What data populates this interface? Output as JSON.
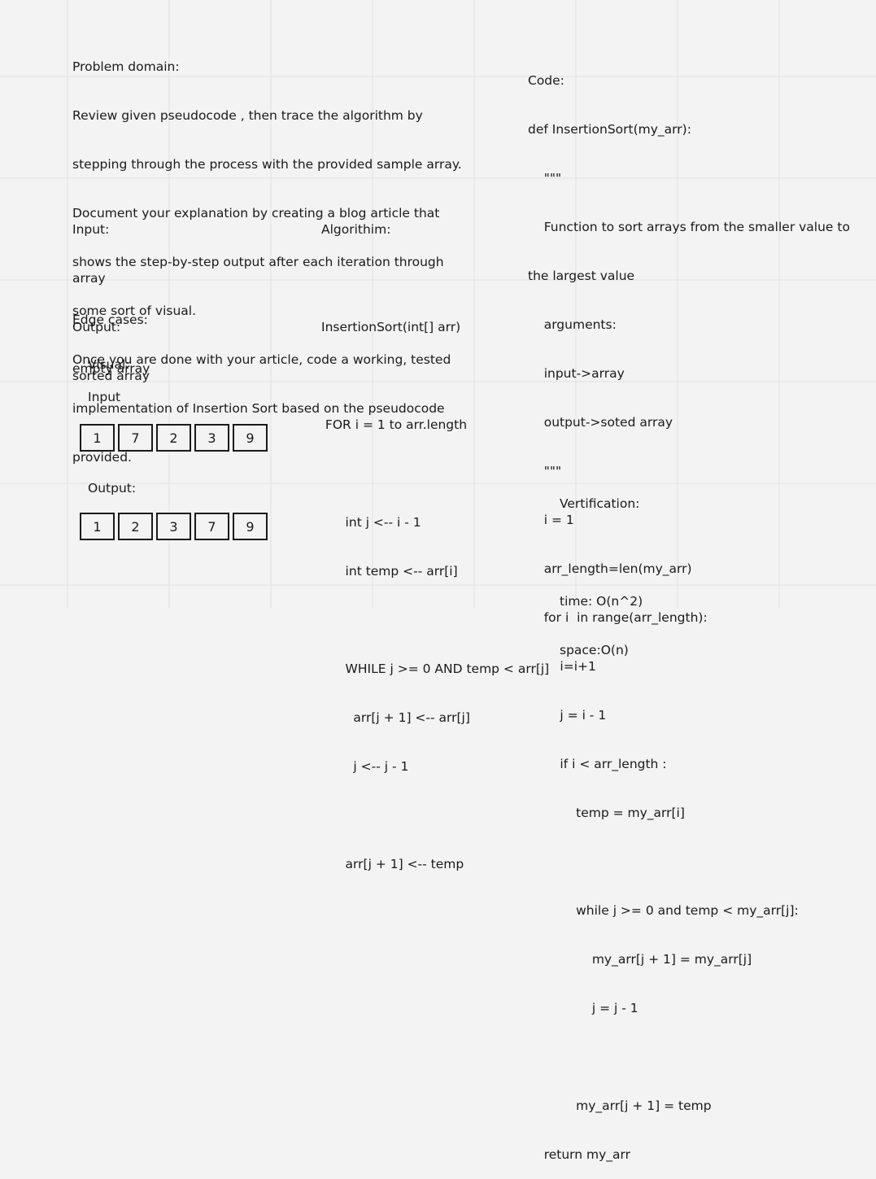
{
  "problem": {
    "lines": [
      "Problem domain:",
      "Review given pseudocode , then trace the algorithm by",
      "stepping through the process with the provided sample array.",
      "Document your explanation by creating a blog article that",
      "shows the step-by-step output after each iteration through",
      "some sort of visual.",
      "Once you are done with your article, code a working, tested",
      "implementation of Insertion Sort based on the pseudocode",
      "provided."
    ]
  },
  "io": {
    "input_label": "Input:",
    "input_value": "array",
    "output_label": "Output:",
    "output_value": "sorted array"
  },
  "edge": {
    "label": "Edge cases:",
    "value": "empty array"
  },
  "visual": {
    "label": "Visual:",
    "input_label": "Input",
    "output_label": "Output:",
    "input_array": [
      "1",
      "7",
      "2",
      "3",
      "9"
    ],
    "output_array": [
      "1",
      "2",
      "3",
      "7",
      "9"
    ]
  },
  "algorithm": {
    "lines": [
      "Algorithim:",
      "",
      "InsertionSort(int[] arr)",
      "",
      " FOR i = 1 to arr.length",
      "",
      "      int j <-- i - 1",
      "      int temp <-- arr[i]",
      "",
      "      WHILE j >= 0 AND temp < arr[j]",
      "        arr[j + 1] <-- arr[j]",
      "        j <-- j - 1",
      "",
      "      arr[j + 1] <-- temp"
    ]
  },
  "code": {
    "lines": [
      "Code:",
      "def InsertionSort(my_arr):",
      "    \"\"\"",
      "    Function to sort arrays from the smaller value to",
      "the largest value",
      "    arguments:",
      "    input->array",
      "    output->soted array",
      "    \"\"\"",
      "    i = 1",
      "    arr_length=len(my_arr)",
      "    for i  in range(arr_length):",
      "        i=i+1",
      "        j = i - 1",
      "        if i < arr_length :",
      "            temp = my_arr[i]",
      "",
      "            while j >= 0 and temp < my_arr[j]:",
      "                my_arr[j + 1] = my_arr[j]",
      "                j = j - 1",
      "",
      "            my_arr[j + 1] = temp",
      "    return my_arr"
    ]
  },
  "verification": {
    "label": "Vertification:",
    "time": "time: O(n^2)",
    "space": "space:O(n)"
  }
}
